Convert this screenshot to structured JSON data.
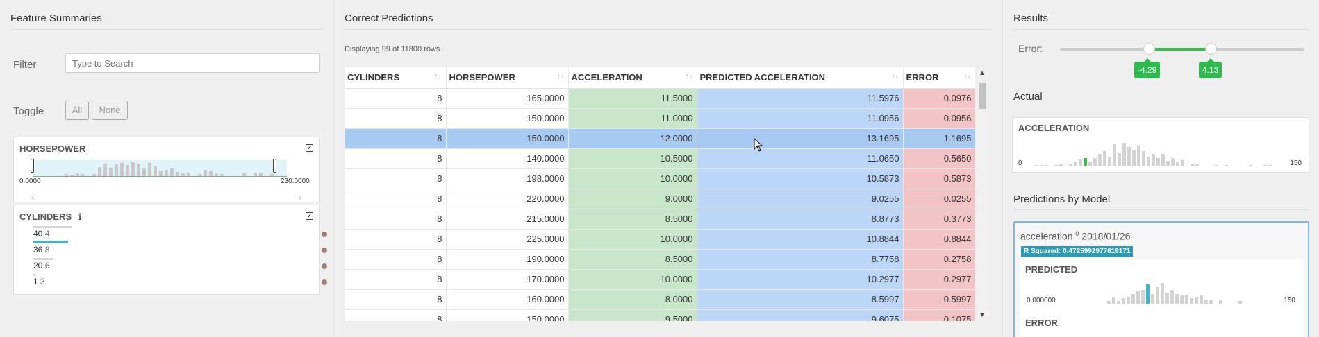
{
  "left": {
    "title": "Feature Summaries",
    "filter_label": "Filter",
    "search_placeholder": "Type to Search",
    "toggle_label": "Toggle",
    "toggle_all": "All",
    "toggle_none": "None",
    "horsepower": {
      "title": "HORSEPOWER",
      "min": "0.0000",
      "max": "230.0000",
      "checked": "✔"
    },
    "cylinders": {
      "title": "CYLINDERS",
      "info": "ℹ",
      "checked": "✔",
      "values": [
        {
          "count": "40",
          "value": "4"
        },
        {
          "count": "36",
          "value": "8"
        },
        {
          "count": "20",
          "value": "6"
        },
        {
          "count": "1",
          "value": "3"
        }
      ]
    }
  },
  "middle": {
    "title": "Correct Predictions",
    "rows_info": "Displaying 99 of 11800 rows",
    "columns": [
      "CYLINDERS",
      "HORSEPOWER",
      "ACCELERATION",
      "PREDICTED ACCELERATION",
      "ERROR"
    ],
    "sort_icon": "↑↓",
    "rows": [
      [
        "8",
        "165.0000",
        "11.5000",
        "11.5976",
        "0.0976"
      ],
      [
        "8",
        "150.0000",
        "11.0000",
        "11.0956",
        "0.0956"
      ],
      [
        "8",
        "150.0000",
        "12.0000",
        "13.1695",
        "1.1695"
      ],
      [
        "8",
        "140.0000",
        "10.5000",
        "11.0650",
        "0.5650"
      ],
      [
        "8",
        "198.0000",
        "10.0000",
        "10.5873",
        "0.5873"
      ],
      [
        "8",
        "220.0000",
        "9.0000",
        "9.0255",
        "0.0255"
      ],
      [
        "8",
        "215.0000",
        "8.5000",
        "8.8773",
        "0.3773"
      ],
      [
        "8",
        "225.0000",
        "10.0000",
        "10.8844",
        "0.8844"
      ],
      [
        "8",
        "190.0000",
        "8.5000",
        "8.7758",
        "0.2758"
      ],
      [
        "8",
        "170.0000",
        "10.0000",
        "10.2977",
        "0.2977"
      ],
      [
        "8",
        "160.0000",
        "8.0000",
        "8.5997",
        "0.5997"
      ],
      [
        "8",
        "150.0000",
        "9.5000",
        "9.6075",
        "0.1075"
      ]
    ]
  },
  "right": {
    "title": "Results",
    "error_label": "Error:",
    "error_low": "-4.29",
    "error_high": "4.13",
    "actual_title": "Actual",
    "actual_hist": {
      "title": "ACCELERATION",
      "min": "0",
      "max": "150"
    },
    "models_title": "Predictions by Model",
    "model": {
      "name": "acceleration",
      "version": "0",
      "date": "2018/01/26",
      "r_squared": "R Squared: 0.4725992977619171",
      "predicted_title": "PREDICTED",
      "predicted_min": "0.000000",
      "predicted_max": "150",
      "error_title": "ERROR"
    }
  }
}
